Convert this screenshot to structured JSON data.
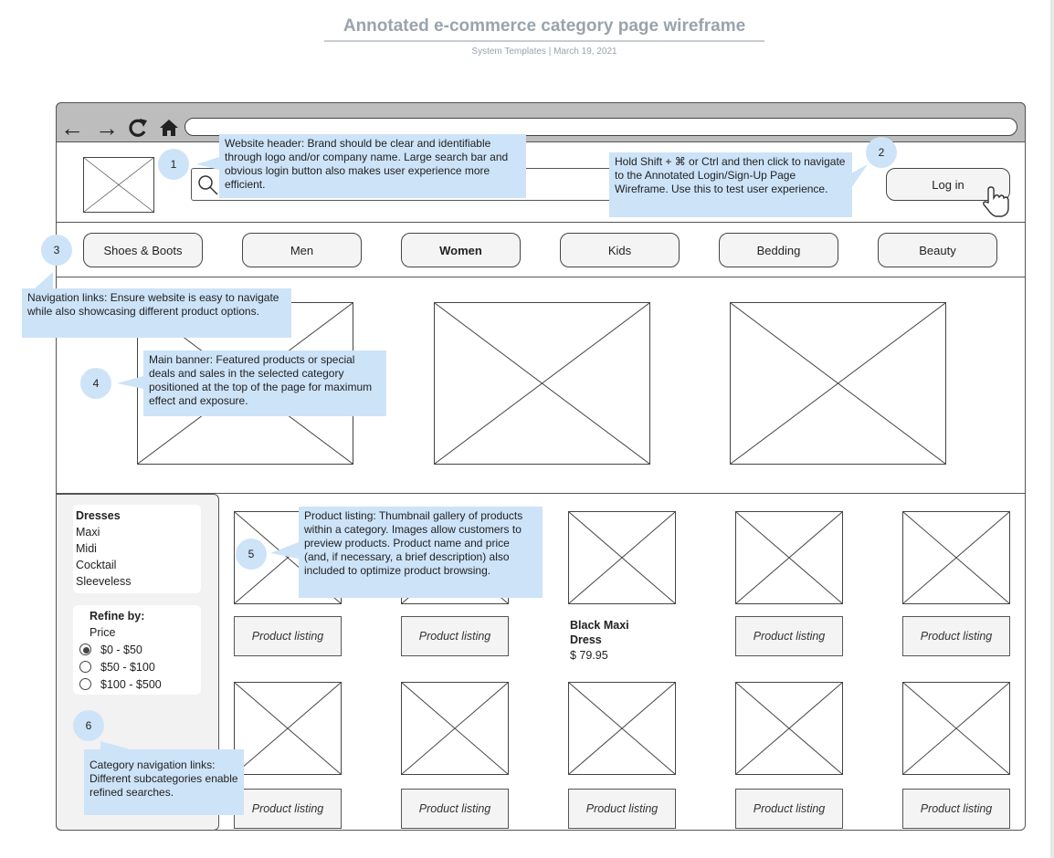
{
  "header": {
    "title": "Annotated e-commerce category page wireframe",
    "subtitle": "System Templates  |  March 19, 2021"
  },
  "browser": {
    "back_icon": "←",
    "forward_icon": "→",
    "reload_icon": "C",
    "home_icon": "⌂"
  },
  "site": {
    "login_label": "Log in",
    "nav": [
      "Shoes & Boots",
      "Men",
      "Women",
      "Kids",
      "Bedding",
      "Beauty"
    ],
    "active_nav": "Women"
  },
  "callouts": {
    "c1": {
      "num": "1",
      "text": "Website header: Brand should be clear and identifiable through logo and/or company name. Large search bar and obvious login button also makes user experience more efficient."
    },
    "c2": {
      "num": "2",
      "text": "Hold Shift + ⌘ or Ctrl and then click to navigate to the Annotated Login/Sign-Up Page Wireframe. Use this to test user experience."
    },
    "c3": {
      "num": "3",
      "text": "Navigation links: Ensure website is easy to navigate while also showcasing different product options."
    },
    "c4": {
      "num": "4",
      "text": "Main banner: Featured products or special deals and sales in the selected category positioned at the top of the page for maximum effect and exposure."
    },
    "c5": {
      "num": "5",
      "text": "Product listing: Thumbnail gallery of products within a category. Images allow customers to preview products. Product name and price (and, if necessary, a brief description) also included to optimize product browsing."
    },
    "c6": {
      "num": "6",
      "text": "Category navigation links: Different subcategories enable refined searches."
    }
  },
  "sidebar": {
    "category_title": "Dresses",
    "subcategories": [
      "Maxi",
      "Midi",
      "Cocktail",
      "Sleeveless"
    ],
    "refine_title": "Refine by:",
    "refine_field": "Price",
    "price_options": [
      "$0 - $50",
      "$50 - $100",
      "$100 - $500"
    ],
    "selected_price": "$0 - $50"
  },
  "products": {
    "listing_label": "Product listing",
    "featured_name": "Black Maxi        Dress",
    "featured_price": "$ 79.95"
  }
}
